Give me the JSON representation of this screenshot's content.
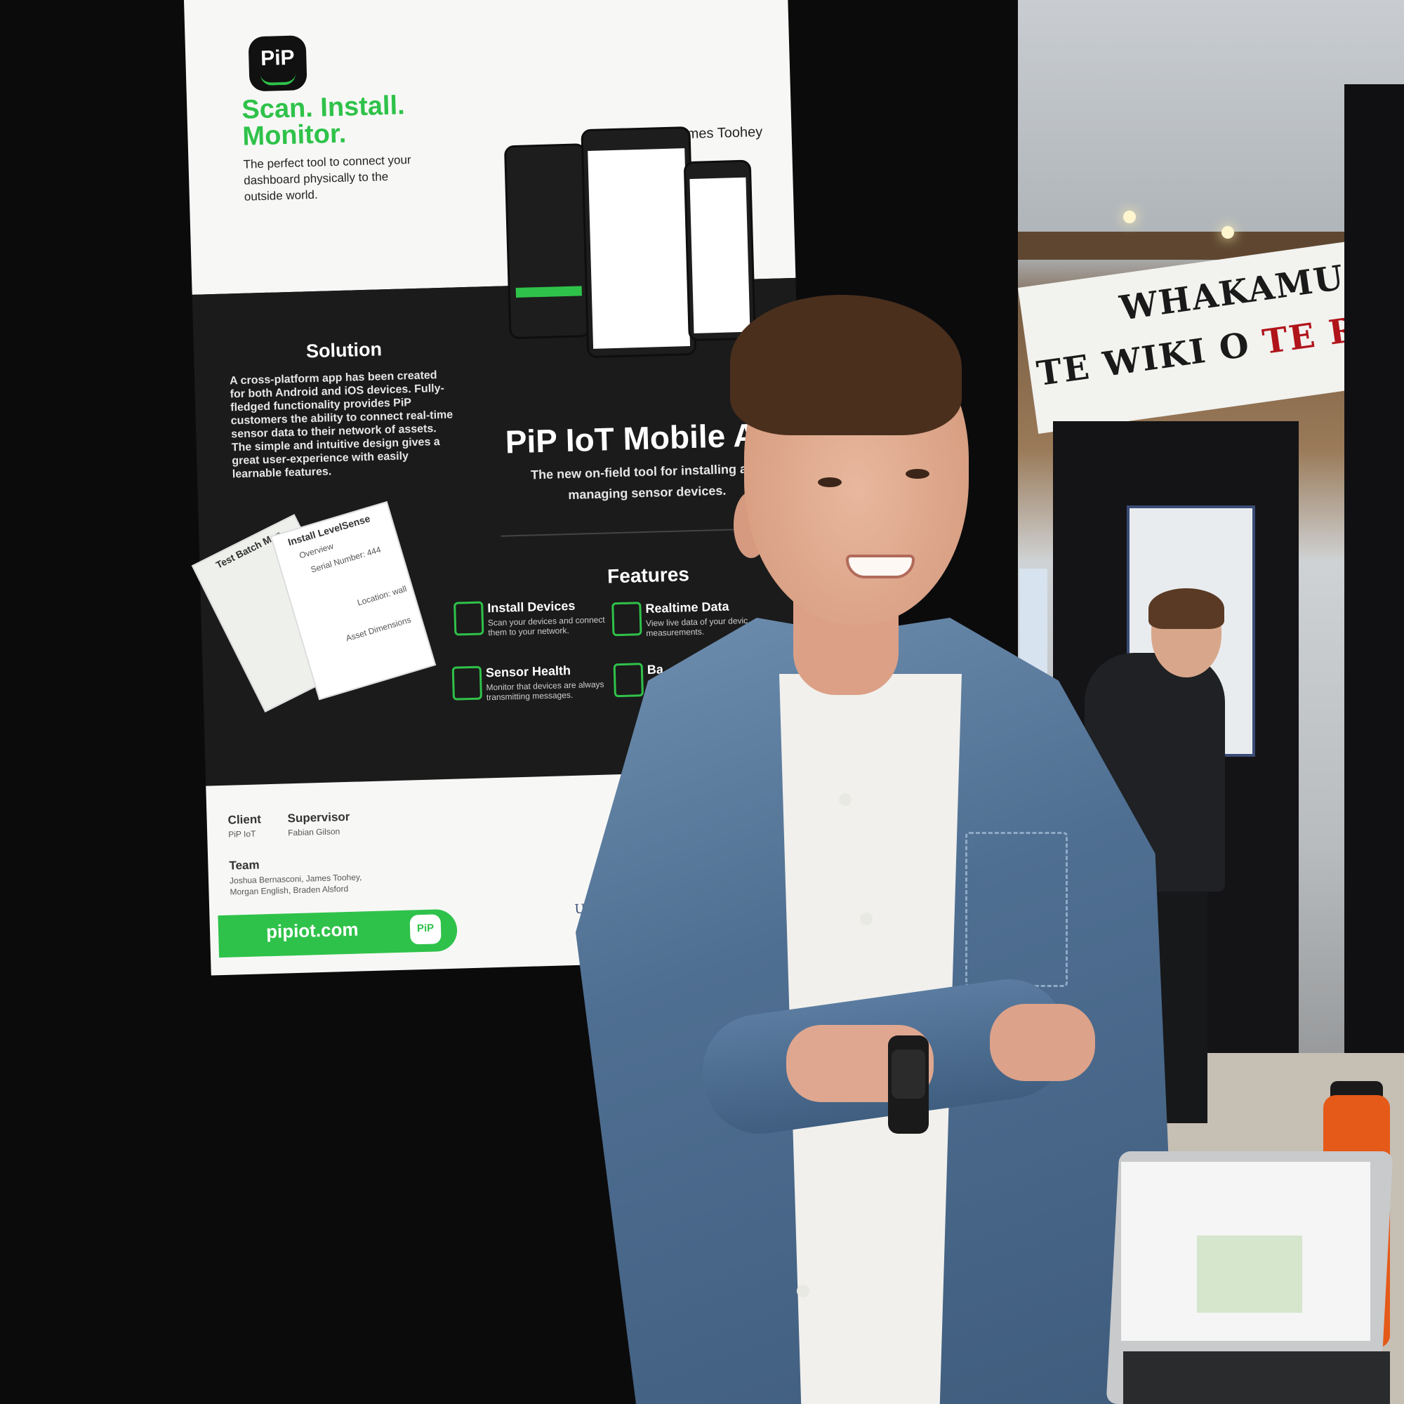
{
  "poster": {
    "logo_text": "PiP",
    "tagline": "Scan. Install. Monitor.",
    "subline": "The perfect tool to connect your dashboard physically to the outside world.",
    "author": "James Toohey",
    "solution_title": "Solution",
    "solution_body": "A cross-platform app has been created for both Android and iOS devices. Fully-fledged functionality provides PiP customers the ability to connect real-time sensor data to their network of assets. The simple and intuitive design gives a great user-experience with easily learnable features.",
    "app_title": "PiP IoT Mobile Ap",
    "app_sub": "The new on-field tool for installing and managing sensor devices.",
    "features_title": "Features",
    "features": [
      {
        "title": "Install Devices",
        "desc": "Scan your devices and connect them to your network.",
        "icon": "walker-icon"
      },
      {
        "title": "Realtime Data",
        "desc": "View live data of your devic measurements.",
        "icon": "signal-icon"
      },
      {
        "title": "Sensor Health",
        "desc": "Monitor that devices are always transmitting messages.",
        "icon": "health-icon"
      },
      {
        "title": "Ba",
        "desc": "",
        "icon": "battery-icon"
      }
    ],
    "client_label": "Client",
    "client_value": "PiP IoT",
    "supervisor_label": "Supervisor",
    "supervisor_value": "Fabian Gilson",
    "team_label": "Team",
    "team_value": "Joshua Bernasconi, James Toohey, Morgan English, Braden Alsford",
    "url": "pipiot.com",
    "uc_text": "UC Comp",
    "map_card_title": "Test Batch Map",
    "install_card_title": "Install LevelSense",
    "install_card_items": [
      "Overview",
      "Serial Number: 444",
      "Location: wall",
      "Asset Dimensions"
    ]
  },
  "banner": {
    "line1": "WHAKAMUA",
    "line2_a": "TE WIKI O ",
    "line2_b": "TE REO MAORI"
  },
  "colors": {
    "accent_green": "#2fc24a",
    "poster_dark": "#1b1b1b",
    "shirt_blue": "#4f6f92",
    "bottle_orange": "#e55a18"
  }
}
